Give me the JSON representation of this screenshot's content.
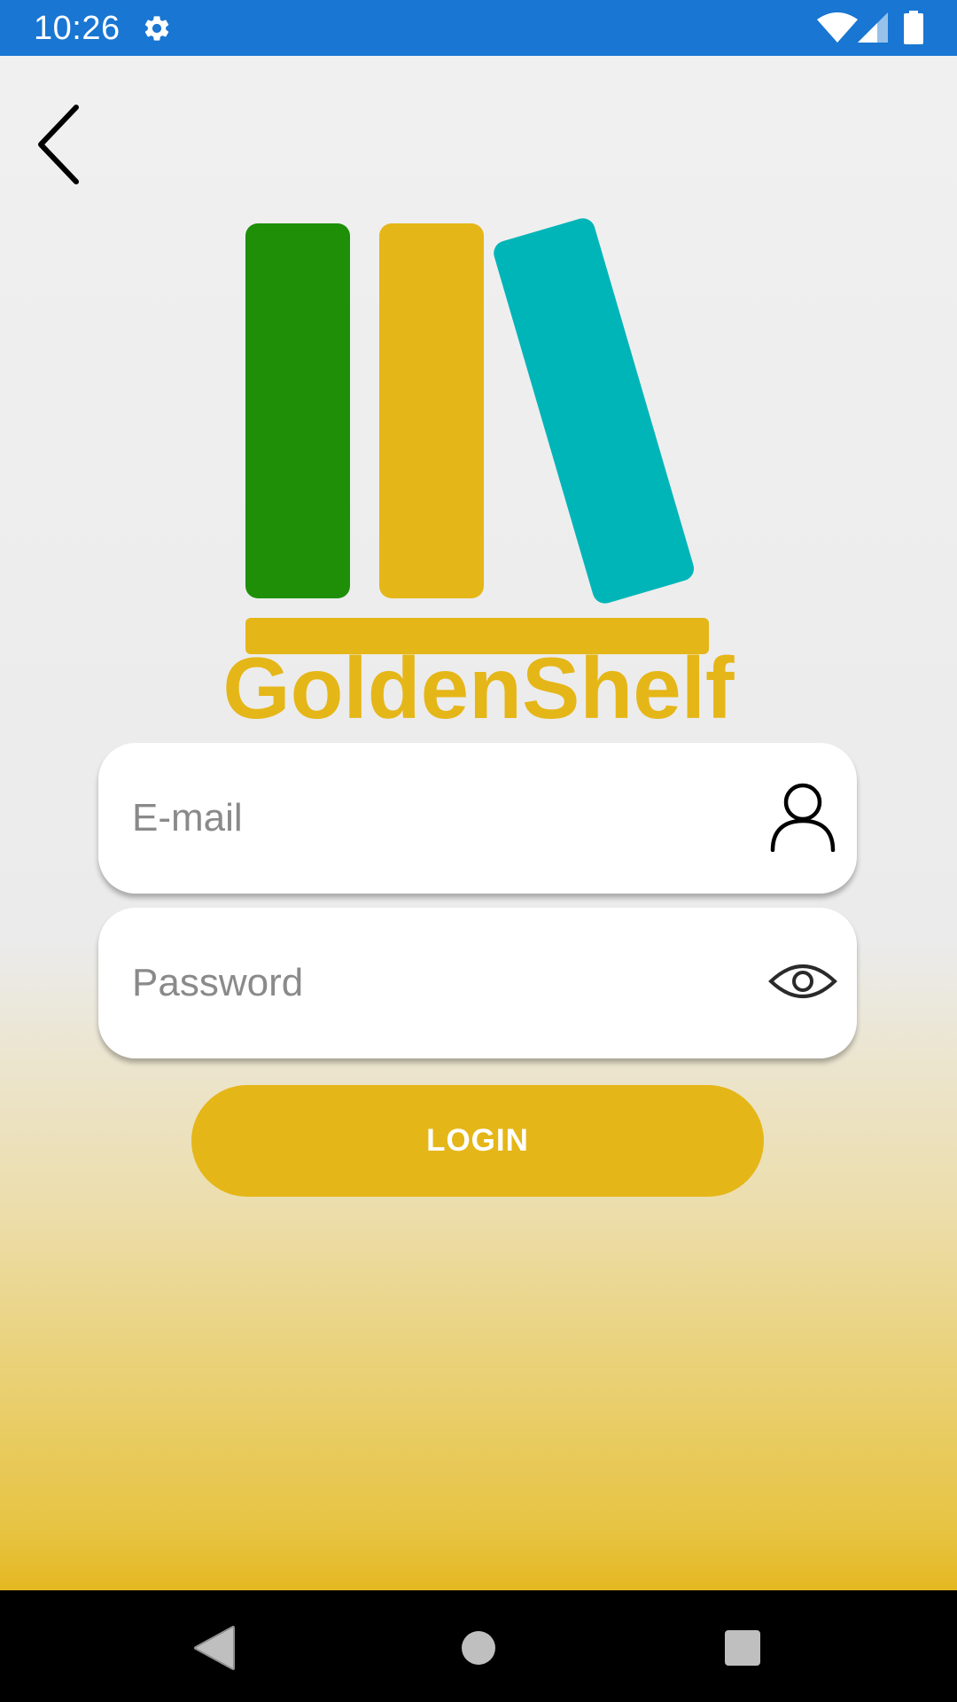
{
  "status_bar": {
    "time": "10:26",
    "icons": [
      "settings-icon",
      "wifi-icon",
      "signal-icon",
      "battery-icon"
    ],
    "background": "#1976d2"
  },
  "header": {
    "back_icon": "chevron-left-icon"
  },
  "logo": {
    "colors": {
      "green_book": "#1e8f07",
      "gold_book": "#e5b617",
      "teal_book": "#00b5b8",
      "shelf": "#e5b617"
    }
  },
  "app_name": "GoldenShelf",
  "form": {
    "email": {
      "placeholder": "E-mail",
      "value": "",
      "icon": "user-icon"
    },
    "password": {
      "placeholder": "Password",
      "value": "",
      "icon": "eye-icon"
    },
    "login_label": "LOGIN"
  },
  "nav_bar": {
    "buttons": [
      "back-triangle-icon",
      "home-circle-icon",
      "recents-square-icon"
    ]
  },
  "colors": {
    "accent": "#e5b617",
    "status_bar": "#1976d2"
  }
}
